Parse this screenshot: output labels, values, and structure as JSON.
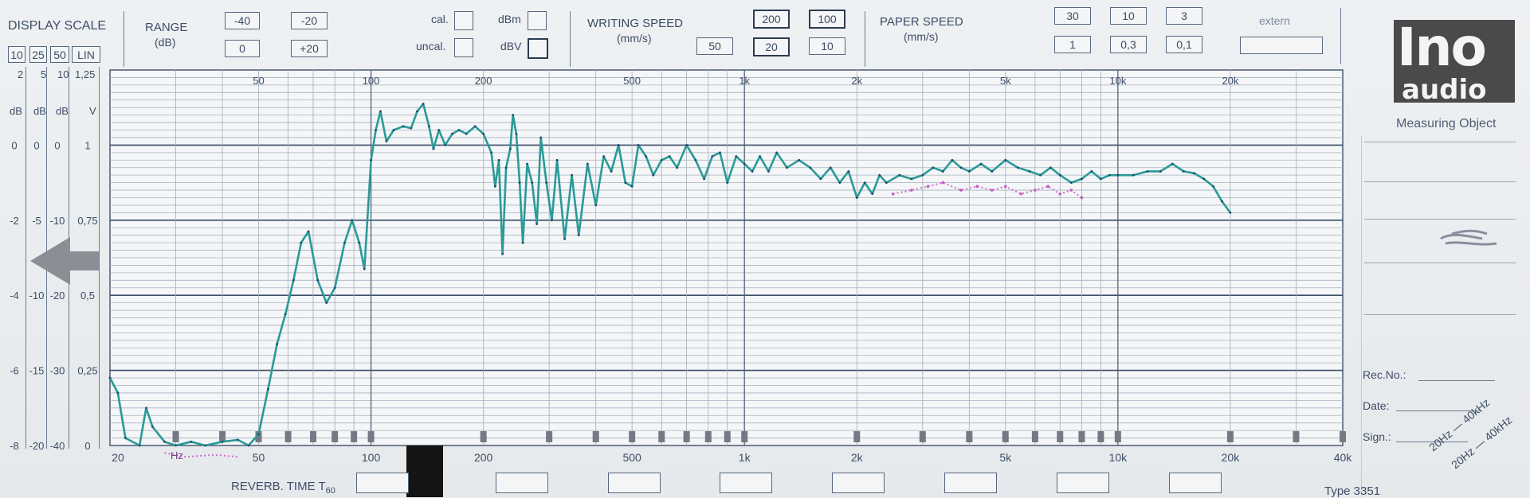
{
  "header": {
    "display_scale": {
      "title": "DISPLAY SCALE",
      "options": [
        "10",
        "25",
        "50",
        "LIN"
      ],
      "units": [
        "dB",
        "dB",
        "dB",
        "V"
      ],
      "scale_top": [
        "2",
        "5",
        "10",
        "1,25"
      ],
      "rows": [
        [
          "0",
          "0",
          "0",
          "1"
        ],
        [
          "-2",
          "-5",
          "-10",
          "0,75"
        ],
        [
          "-4",
          "-10",
          "-20",
          "0,5"
        ],
        [
          "-6",
          "-15",
          "-30",
          "0,25"
        ],
        [
          "-8",
          "-20",
          "-40",
          "0"
        ]
      ]
    },
    "range": {
      "title": "RANGE",
      "unit": "(dB)",
      "values": [
        "-40",
        "-20",
        "0",
        "+20"
      ]
    },
    "checks": {
      "cal": "cal.",
      "uncal": "uncal.",
      "dbm": "dBm",
      "dbv": "dBV"
    },
    "writing_speed": {
      "title": "WRITING SPEED",
      "unit": "(mm/s)",
      "values": [
        "200",
        "100",
        "50",
        "20",
        "10"
      ]
    },
    "paper_speed": {
      "title": "PAPER SPEED",
      "unit": "(mm/s)",
      "values": [
        "30",
        "10",
        "3",
        "1",
        "0,3",
        "0,1"
      ],
      "extern": "extern"
    }
  },
  "logo": {
    "line1": "Ino",
    "line2": "audio"
  },
  "side_panel": {
    "measuring_object": "Measuring Object",
    "rec_no": "Rec.No.:",
    "date": "Date:",
    "sign": "Sign.:",
    "diag1": "20Hz — 40kHz",
    "diag2": "20Hz — 40kHz",
    "type": "Type 3351"
  },
  "bottom": {
    "reverb_label": "REVERB. TIME T",
    "reverb_sub": "60",
    "hz": "Hz"
  },
  "chart_data": {
    "type": "line",
    "xscale": "log",
    "xlim": [
      20,
      40000
    ],
    "ylim": [
      -8,
      2
    ],
    "ylabel": "dB",
    "grid": true,
    "x_ticks_top": [
      "50",
      "100",
      "200",
      "500",
      "1k",
      "2k",
      "5k",
      "10k",
      "20k"
    ],
    "x_ticks_bottom": [
      "20",
      "50",
      "100",
      "200",
      "500",
      "1k",
      "2k",
      "5k",
      "10k",
      "20k",
      "40k"
    ],
    "series": [
      {
        "color": "#2a9a98",
        "points": [
          [
            20,
            -6.2
          ],
          [
            21,
            -6.6
          ],
          [
            22,
            -7.8
          ],
          [
            24,
            -8.0
          ],
          [
            25,
            -7.0
          ],
          [
            26,
            -7.5
          ],
          [
            28,
            -7.9
          ],
          [
            30,
            -8.0
          ],
          [
            33,
            -7.9
          ],
          [
            36,
            -8.0
          ],
          [
            40,
            -7.9
          ],
          [
            44,
            -7.85
          ],
          [
            47,
            -8.0
          ],
          [
            50,
            -7.7
          ],
          [
            53,
            -6.5
          ],
          [
            56,
            -5.3
          ],
          [
            59,
            -4.5
          ],
          [
            62,
            -3.6
          ],
          [
            65,
            -2.6
          ],
          [
            68,
            -2.3
          ],
          [
            72,
            -3.6
          ],
          [
            76,
            -4.2
          ],
          [
            80,
            -3.8
          ],
          [
            85,
            -2.6
          ],
          [
            89,
            -2.0
          ],
          [
            93,
            -2.6
          ],
          [
            96,
            -3.3
          ],
          [
            100,
            -0.4
          ],
          [
            103,
            0.4
          ],
          [
            106,
            0.9
          ],
          [
            110,
            0.1
          ],
          [
            115,
            0.4
          ],
          [
            122,
            0.5
          ],
          [
            128,
            0.45
          ],
          [
            133,
            0.9
          ],
          [
            138,
            1.1
          ],
          [
            143,
            0.5
          ],
          [
            147,
            -0.1
          ],
          [
            152,
            0.4
          ],
          [
            158,
            0.0
          ],
          [
            165,
            0.3
          ],
          [
            172,
            0.4
          ],
          [
            180,
            0.3
          ],
          [
            190,
            0.5
          ],
          [
            200,
            0.3
          ],
          [
            210,
            -0.2
          ],
          [
            215,
            -1.1
          ],
          [
            220,
            -0.4
          ],
          [
            225,
            -2.9
          ],
          [
            230,
            -0.6
          ],
          [
            236,
            -0.1
          ],
          [
            240,
            0.8
          ],
          [
            245,
            0.3
          ],
          [
            250,
            -1.0
          ],
          [
            255,
            -2.6
          ],
          [
            262,
            -0.5
          ],
          [
            270,
            -1.0
          ],
          [
            278,
            -2.1
          ],
          [
            285,
            0.2
          ],
          [
            295,
            -1.0
          ],
          [
            305,
            -2.0
          ],
          [
            315,
            -0.4
          ],
          [
            330,
            -2.5
          ],
          [
            345,
            -0.8
          ],
          [
            360,
            -2.4
          ],
          [
            380,
            -0.5
          ],
          [
            400,
            -1.6
          ],
          [
            420,
            -0.3
          ],
          [
            440,
            -0.7
          ],
          [
            460,
            0.0
          ],
          [
            480,
            -1.0
          ],
          [
            500,
            -1.1
          ],
          [
            520,
            0.0
          ],
          [
            545,
            -0.3
          ],
          [
            570,
            -0.8
          ],
          [
            600,
            -0.4
          ],
          [
            630,
            -0.3
          ],
          [
            660,
            -0.6
          ],
          [
            700,
            0.0
          ],
          [
            740,
            -0.4
          ],
          [
            780,
            -0.9
          ],
          [
            820,
            -0.3
          ],
          [
            860,
            -0.2
          ],
          [
            900,
            -1.0
          ],
          [
            950,
            -0.3
          ],
          [
            1000,
            -0.5
          ],
          [
            1050,
            -0.7
          ],
          [
            1100,
            -0.3
          ],
          [
            1160,
            -0.7
          ],
          [
            1220,
            -0.2
          ],
          [
            1300,
            -0.6
          ],
          [
            1400,
            -0.4
          ],
          [
            1500,
            -0.6
          ],
          [
            1600,
            -0.9
          ],
          [
            1700,
            -0.6
          ],
          [
            1800,
            -1.0
          ],
          [
            1900,
            -0.7
          ],
          [
            2000,
            -1.4
          ],
          [
            2100,
            -1.0
          ],
          [
            2200,
            -1.3
          ],
          [
            2300,
            -0.8
          ],
          [
            2400,
            -1.0
          ],
          [
            2600,
            -0.8
          ],
          [
            2800,
            -0.9
          ],
          [
            3000,
            -0.8
          ],
          [
            3200,
            -0.6
          ],
          [
            3400,
            -0.7
          ],
          [
            3600,
            -0.4
          ],
          [
            3800,
            -0.6
          ],
          [
            4000,
            -0.7
          ],
          [
            4300,
            -0.5
          ],
          [
            4600,
            -0.7
          ],
          [
            5000,
            -0.4
          ],
          [
            5400,
            -0.6
          ],
          [
            5800,
            -0.7
          ],
          [
            6200,
            -0.8
          ],
          [
            6600,
            -0.6
          ],
          [
            7000,
            -0.8
          ],
          [
            7500,
            -1.0
          ],
          [
            8000,
            -0.9
          ],
          [
            8500,
            -0.7
          ],
          [
            9000,
            -0.9
          ],
          [
            9500,
            -0.8
          ],
          [
            10000,
            -0.8
          ],
          [
            11000,
            -0.8
          ],
          [
            12000,
            -0.7
          ],
          [
            13000,
            -0.7
          ],
          [
            14000,
            -0.5
          ],
          [
            15000,
            -0.7
          ],
          [
            16000,
            -0.75
          ],
          [
            17000,
            -0.9
          ],
          [
            18000,
            -1.1
          ],
          [
            19000,
            -1.5
          ],
          [
            20000,
            -1.8
          ]
        ]
      },
      {
        "color": "#c45cc2",
        "points": [
          [
            28,
            -8.2
          ],
          [
            32,
            -8.3
          ],
          [
            38,
            -8.25
          ],
          [
            44,
            -8.3
          ],
          [
            2500,
            -1.3
          ],
          [
            2800,
            -1.2
          ],
          [
            3100,
            -1.1
          ],
          [
            3400,
            -1.0
          ],
          [
            3800,
            -1.2
          ],
          [
            4200,
            -1.1
          ],
          [
            4600,
            -1.2
          ],
          [
            5000,
            -1.1
          ],
          [
            5500,
            -1.3
          ],
          [
            6000,
            -1.2
          ],
          [
            6500,
            -1.1
          ],
          [
            7000,
            -1.3
          ],
          [
            7500,
            -1.2
          ],
          [
            8000,
            -1.4
          ]
        ]
      }
    ]
  }
}
